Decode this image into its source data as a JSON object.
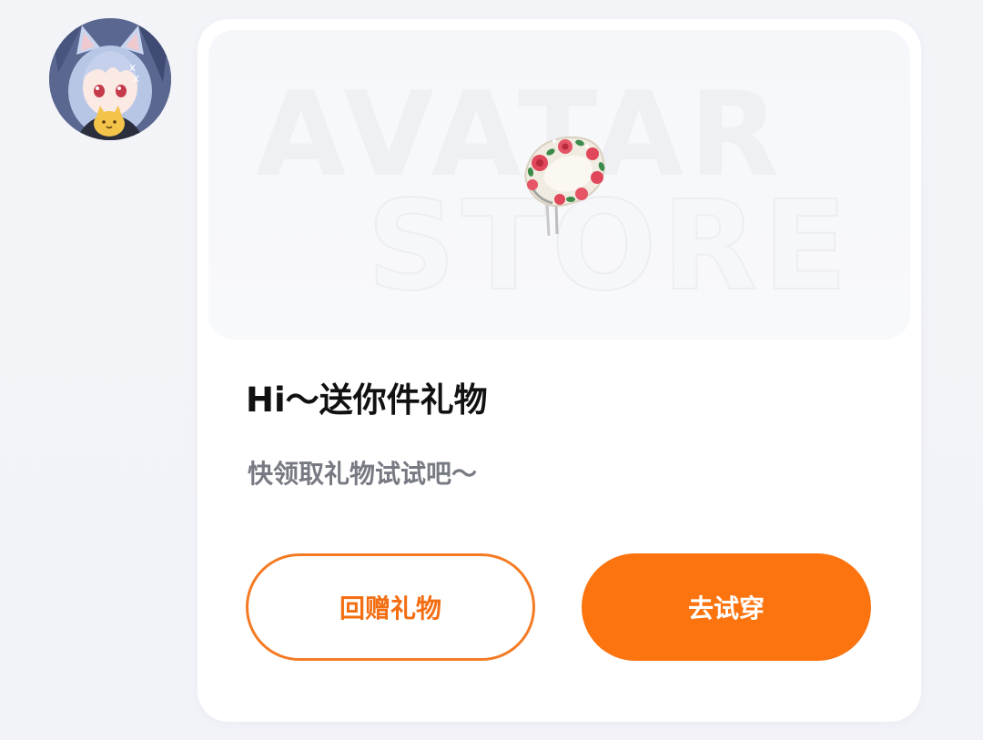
{
  "avatar": {
    "icon": "anime-cat-girl-avatar"
  },
  "banner": {
    "bg_text_line1": "AVATAR",
    "bg_text_line2": "STORE",
    "item_icon": "floral-headband-icon"
  },
  "gift": {
    "title": "Hi～送你件礼物",
    "subtitle": "快领取礼物试试吧～"
  },
  "actions": {
    "return_gift_label": "回赠礼物",
    "try_on_label": "去试穿"
  },
  "colors": {
    "accent": "#fb7410",
    "outline": "#f47b24"
  }
}
